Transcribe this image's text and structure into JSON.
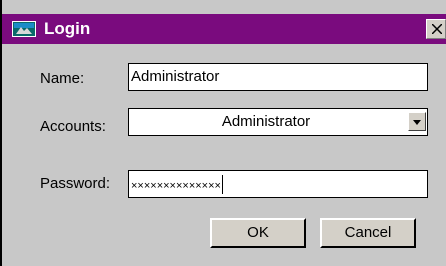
{
  "window": {
    "title": "Login"
  },
  "form": {
    "name_label": "Name:",
    "name_value": "Administrator",
    "accounts_label": "Accounts:",
    "accounts_selected": "Administrator",
    "password_label": "Password:",
    "password_masked": "××××××××××××××"
  },
  "buttons": {
    "ok_label": "OK",
    "cancel_label": "Cancel"
  },
  "colors": {
    "titlebar": "#7a0b7e",
    "dialog_bg": "#c8c8c8"
  }
}
